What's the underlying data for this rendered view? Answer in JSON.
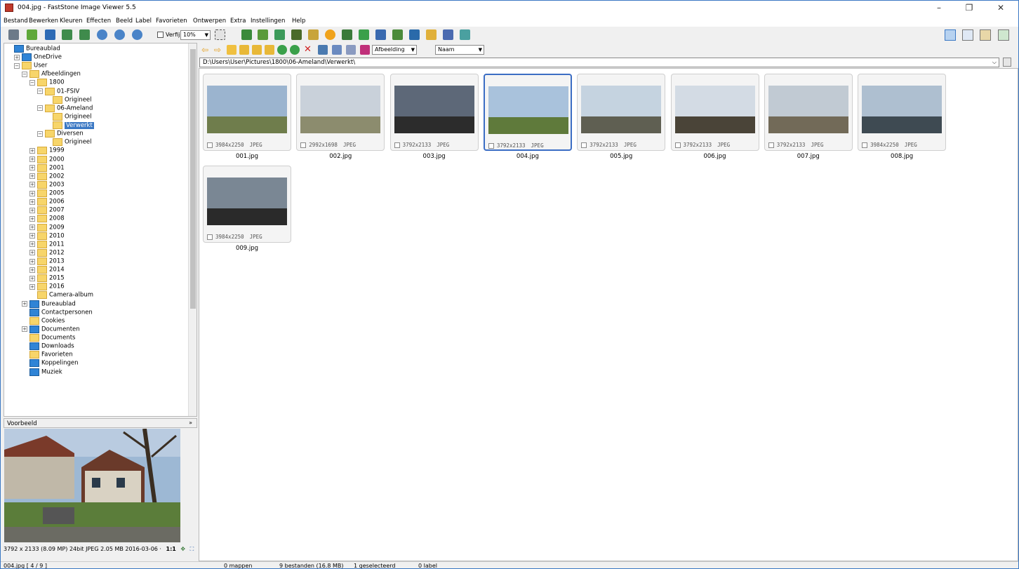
{
  "window": {
    "title": "004.jpg  -  FastStone Image Viewer 5.5",
    "minimize": "–",
    "restore": "❐",
    "close": "✕"
  },
  "menu": [
    "Bestand",
    "Bewerken",
    "Kleuren",
    "Effecten",
    "Beeld",
    "Label",
    "Favorieten",
    "Ontwerpen",
    "Extra",
    "Instellingen",
    "Help"
  ],
  "toolbar": {
    "verfijn_label": "Verfijn",
    "zoom_value": "10%"
  },
  "tree": [
    {
      "label": "Bureaublad",
      "depth": 0,
      "folder": "blue",
      "exp": ""
    },
    {
      "label": "OneDrive",
      "depth": 1,
      "folder": "blue",
      "exp": "+"
    },
    {
      "label": "User",
      "depth": 1,
      "folder": "yellow",
      "exp": "−"
    },
    {
      "label": "Afbeeldingen",
      "depth": 2,
      "folder": "yellow",
      "exp": "−"
    },
    {
      "label": "1800",
      "depth": 3,
      "folder": "yellow",
      "exp": "−"
    },
    {
      "label": "01-FSIV",
      "depth": 4,
      "folder": "yellow",
      "exp": "−"
    },
    {
      "label": "Origineel",
      "depth": 5,
      "folder": "yellow",
      "exp": ""
    },
    {
      "label": "06-Ameland",
      "depth": 4,
      "folder": "yellow",
      "exp": "−"
    },
    {
      "label": "Origineel",
      "depth": 5,
      "folder": "yellow",
      "exp": ""
    },
    {
      "label": "Verwerkt",
      "depth": 5,
      "folder": "yellow",
      "exp": "",
      "selected": true
    },
    {
      "label": "Diversen",
      "depth": 4,
      "folder": "yellow",
      "exp": "−"
    },
    {
      "label": "Origineel",
      "depth": 5,
      "folder": "yellow",
      "exp": ""
    },
    {
      "label": "1999",
      "depth": 3,
      "folder": "yellow",
      "exp": "+"
    },
    {
      "label": "2000",
      "depth": 3,
      "folder": "yellow",
      "exp": "+"
    },
    {
      "label": "2001",
      "depth": 3,
      "folder": "yellow",
      "exp": "+"
    },
    {
      "label": "2002",
      "depth": 3,
      "folder": "yellow",
      "exp": "+"
    },
    {
      "label": "2003",
      "depth": 3,
      "folder": "yellow",
      "exp": "+"
    },
    {
      "label": "2005",
      "depth": 3,
      "folder": "yellow",
      "exp": "+"
    },
    {
      "label": "2006",
      "depth": 3,
      "folder": "yellow",
      "exp": "+"
    },
    {
      "label": "2007",
      "depth": 3,
      "folder": "yellow",
      "exp": "+"
    },
    {
      "label": "2008",
      "depth": 3,
      "folder": "yellow",
      "exp": "+"
    },
    {
      "label": "2009",
      "depth": 3,
      "folder": "yellow",
      "exp": "+"
    },
    {
      "label": "2010",
      "depth": 3,
      "folder": "yellow",
      "exp": "+"
    },
    {
      "label": "2011",
      "depth": 3,
      "folder": "yellow",
      "exp": "+"
    },
    {
      "label": "2012",
      "depth": 3,
      "folder": "yellow",
      "exp": "+"
    },
    {
      "label": "2013",
      "depth": 3,
      "folder": "yellow",
      "exp": "+"
    },
    {
      "label": "2014",
      "depth": 3,
      "folder": "yellow",
      "exp": "+"
    },
    {
      "label": "2015",
      "depth": 3,
      "folder": "yellow",
      "exp": "+"
    },
    {
      "label": "2016",
      "depth": 3,
      "folder": "yellow",
      "exp": "+"
    },
    {
      "label": "Camera-album",
      "depth": 3,
      "folder": "yellow",
      "exp": ""
    },
    {
      "label": "Bureaublad",
      "depth": 2,
      "folder": "blue",
      "exp": "+"
    },
    {
      "label": "Contactpersonen",
      "depth": 2,
      "folder": "blue",
      "exp": ""
    },
    {
      "label": "Cookies",
      "depth": 2,
      "folder": "yellow",
      "exp": ""
    },
    {
      "label": "Documenten",
      "depth": 2,
      "folder": "blue",
      "exp": "+"
    },
    {
      "label": "Documents",
      "depth": 2,
      "folder": "yellow",
      "exp": ""
    },
    {
      "label": "Downloads",
      "depth": 2,
      "folder": "blue",
      "exp": ""
    },
    {
      "label": "Favorieten",
      "depth": 2,
      "folder": "yellow",
      "exp": ""
    },
    {
      "label": "Koppelingen",
      "depth": 2,
      "folder": "blue",
      "exp": ""
    },
    {
      "label": "Muziek",
      "depth": 2,
      "folder": "blue",
      "exp": ""
    }
  ],
  "preview": {
    "title": "Voorbeeld",
    "collapse": "»",
    "info": "3792 x 2133 (8.09 MP)  24bit  JPEG  2.05 MB  2016-03-06 ·",
    "ratio": "1:1"
  },
  "nav": {
    "sort_type": "Afbeelding",
    "sort_by": "Naam"
  },
  "path": "D:\\Users\\User\\Pictures\\1800\\06-Ameland\\Verwerkt\\",
  "thumbnails": [
    {
      "name": "001.jpg",
      "dims": "3984x2250",
      "format": "JPEG",
      "sky": "#9bb4cf",
      "ground": "#6f7d4c",
      "selected": false
    },
    {
      "name": "002.jpg",
      "dims": "2992x1698",
      "format": "JPEG",
      "sky": "#c9d1da",
      "ground": "#8c8c6e",
      "selected": false
    },
    {
      "name": "003.jpg",
      "dims": "3792x2133",
      "format": "JPEG",
      "sky": "#5d6878",
      "ground": "#2c2c2c",
      "selected": false
    },
    {
      "name": "004.jpg",
      "dims": "3792x2133",
      "format": "JPEG",
      "sky": "#a9c2dc",
      "ground": "#5f7a3b",
      "selected": true
    },
    {
      "name": "005.jpg",
      "dims": "3792x2133",
      "format": "JPEG",
      "sky": "#c5d3e0",
      "ground": "#5f5f52",
      "selected": false
    },
    {
      "name": "006.jpg",
      "dims": "3792x2133",
      "format": "JPEG",
      "sky": "#d3dbe4",
      "ground": "#4a4438",
      "selected": false
    },
    {
      "name": "007.jpg",
      "dims": "3792x2133",
      "format": "JPEG",
      "sky": "#c1cad3",
      "ground": "#726a58",
      "selected": false
    },
    {
      "name": "008.jpg",
      "dims": "3984x2250",
      "format": "JPEG",
      "sky": "#aebfd0",
      "ground": "#3e4a52",
      "selected": false
    },
    {
      "name": "009.jpg",
      "dims": "3984x2250",
      "format": "JPEG",
      "sky": "#7a8794",
      "ground": "#2a2a2a",
      "selected": false
    }
  ],
  "status": {
    "file": "004.jpg [ 4 / 9 ]",
    "folders": "0 mappen",
    "files": "9 bestanden (16.8 MB)",
    "selected": "1 geselecteerd",
    "labels": "0 label"
  },
  "colors": {
    "accent": "#3b78c4",
    "selection_border": "#3b6dc4",
    "folder_yellow": "#f7d56a",
    "folder_blue": "#2f84d6"
  }
}
